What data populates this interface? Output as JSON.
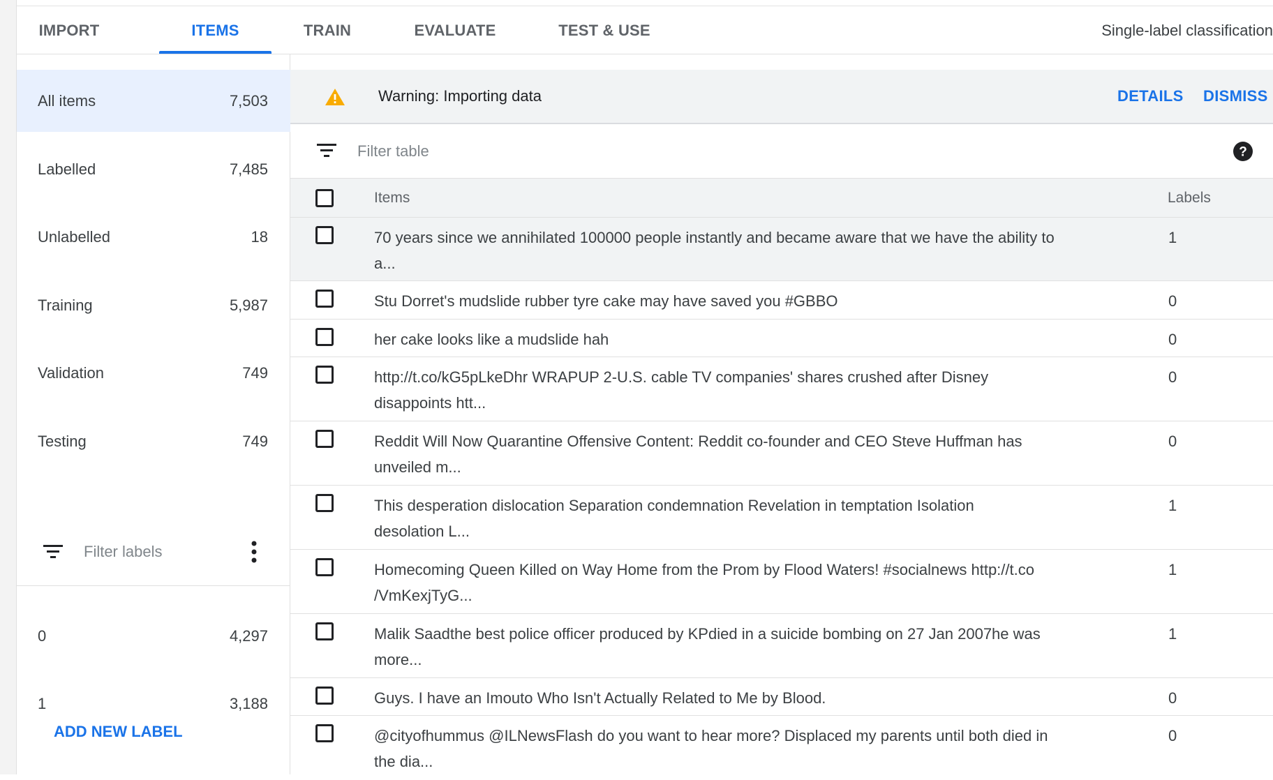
{
  "tabs": [
    {
      "label": "IMPORT"
    },
    {
      "label": "ITEMS"
    },
    {
      "label": "TRAIN"
    },
    {
      "label": "EVALUATE"
    },
    {
      "label": "TEST & USE"
    }
  ],
  "active_tab": "ITEMS",
  "model_type": "Single-label classification",
  "sidebar": {
    "items": [
      {
        "label": "All items",
        "count": "7,503"
      },
      {
        "label": "Labelled",
        "count": "7,485"
      },
      {
        "label": "Unlabelled",
        "count": "18"
      },
      {
        "label": "Training",
        "count": "5,987"
      },
      {
        "label": "Validation",
        "count": "749"
      },
      {
        "label": "Testing",
        "count": "749"
      }
    ],
    "active_item": "All items",
    "filter_placeholder": "Filter labels",
    "labels": [
      {
        "label": "0",
        "count": "4,297"
      },
      {
        "label": "1",
        "count": "3,188"
      }
    ],
    "add_label": "ADD NEW LABEL"
  },
  "warning": {
    "text": "Warning: Importing data",
    "details": "DETAILS",
    "dismiss": "DISMISS",
    "color": "#f9ab00"
  },
  "filter_table_placeholder": "Filter table",
  "table": {
    "columns": {
      "items": "Items",
      "labels": "Labels"
    },
    "rows": [
      {
        "lines": [
          "70 years since we annihilated 100000 people instantly and became aware that we have the ability to",
          "a..."
        ],
        "label": "1"
      },
      {
        "lines": [
          "Stu Dorret's mudslide rubber tyre cake may have saved you #GBBO"
        ],
        "label": "0"
      },
      {
        "lines": [
          "her cake looks like a mudslide hah"
        ],
        "label": "0"
      },
      {
        "lines": [
          "http://t.co/kG5pLkeDhr WRAPUP 2-U.S. cable TV companies' shares crushed after Disney",
          "disappoints htt..."
        ],
        "label": "0"
      },
      {
        "lines": [
          "Reddit Will Now Quarantine Offensive Content: Reddit co-founder and CEO Steve Huffman has",
          "unveiled m..."
        ],
        "label": "0"
      },
      {
        "lines": [
          "This desperation dislocation Separation condemnation Revelation in temptation Isolation",
          "desolation L..."
        ],
        "label": "1"
      },
      {
        "lines": [
          "Homecoming Queen Killed on Way Home from the Prom by Flood Waters! #socialnews http://t.co",
          "/VmKexjTyG..."
        ],
        "label": "1"
      },
      {
        "lines": [
          "Malik Saadthe best police officer produced by KPdied in a suicide bombing on 27 Jan 2007he was",
          "more..."
        ],
        "label": "1"
      },
      {
        "lines": [
          "Guys. I have an Imouto Who Isn't Actually Related to Me by Blood."
        ],
        "label": "0"
      },
      {
        "lines": [
          "@cityofhummus @ILNewsFlash do you want to hear more? Displaced my parents until both died in",
          "the dia..."
        ],
        "label": "0"
      }
    ]
  },
  "colors": {
    "accent": "#1a73e8",
    "selected_bg": "#e8f0fe",
    "warning": "#f9ab00"
  }
}
